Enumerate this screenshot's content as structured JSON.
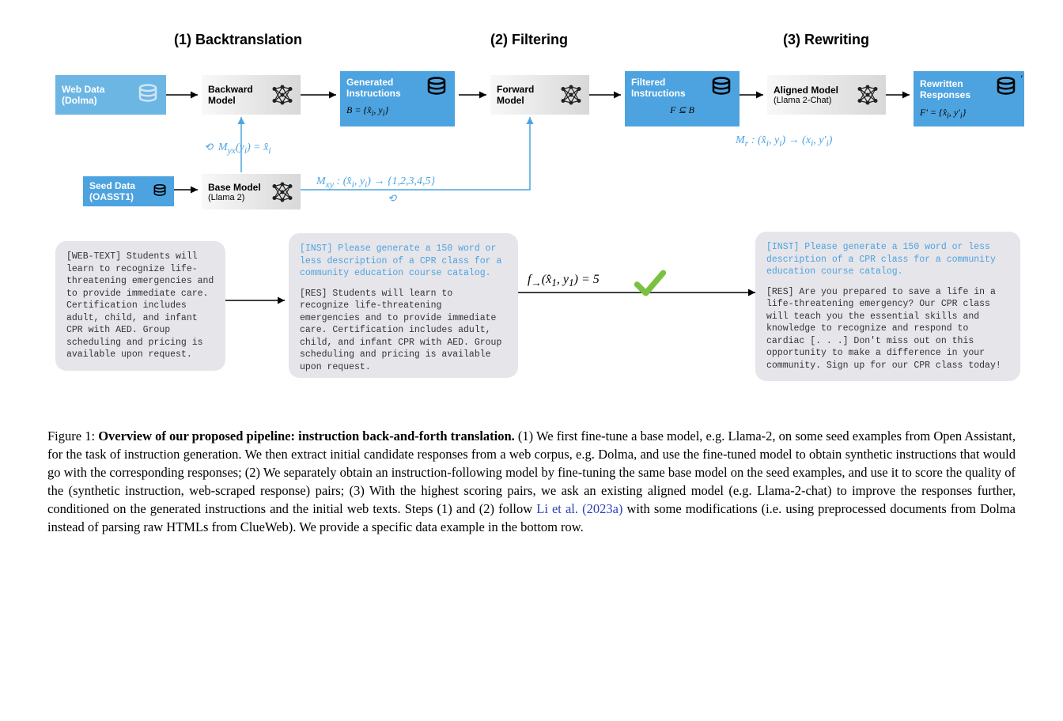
{
  "stages": {
    "s1": "(1) Backtranslation",
    "s2": "(2) Filtering",
    "s3": "(3) Rewriting"
  },
  "boxes": {
    "webdata": "Web Data (Dolma)",
    "seeddata": "Seed Data (OASST1)",
    "backward": "Backward Model",
    "basemodel1": "Base Model",
    "basemodel1b": "(Llama 2)",
    "generated": "Generated Instructions",
    "forward": "Forward Model",
    "filtered": "Filtered Instructions",
    "aligned1": "Aligned Model",
    "aligned2": "(Llama 2-Chat)",
    "rewritten": "Rewritten Responses"
  },
  "math": {
    "myx": "M_{yx}(y_i) = x̂_i",
    "bset": "B = {x̂_i, y_i}",
    "mxy": "M_{xy} : (x̂_i, y_i) → {1,2,3,4,5}",
    "fsub": "F ⊆ B",
    "mr": "M_r : (x̂_i, y_i) → (x_i, y_i')",
    "fprime": "F' = {x̂_i, y_i'}",
    "score": "f_→(x̂_1, y_1) = 5"
  },
  "examples": {
    "webtext": "[WEB-TEXT] Students will learn to recognize life-threatening emergencies and to provide immediate care. Certification includes adult, child, and infant CPR with AED. Group scheduling and pricing is available upon request.",
    "inst1": "[INST] Please generate a 150 word or less description of a CPR class for a community education course catalog.",
    "res1": "[RES] Students will learn to recognize life-threatening emergencies and to provide immediate care. Certification includes adult, child, and infant CPR with AED. Group scheduling and pricing is available upon request.",
    "inst2": "[INST] Please generate a 150 word or less description of a CPR class for a community education course catalog.",
    "res2": "[RES] Are you prepared to save a life in a life-threatening emergency? Our CPR class will teach you the essential skills and knowledge to recognize and respond to cardiac [. . .] Don't miss out on this opportunity to make a difference in your community. Sign up for our CPR class today!"
  },
  "caption": {
    "fignum": "Figure 1: ",
    "boldtitle": "Overview of our proposed pipeline: instruction back-and-forth translation.",
    "body1": " (1) We first fine-tune a base model, e.g. Llama-2, on some seed examples from Open Assistant, for the task of instruction generation. We then extract initial candidate responses from a web corpus, e.g. Dolma, and use the fine-tuned model to obtain synthetic instructions that would go with the corresponding responses; (2) We separately obtain an instruction-following model by fine-tuning the same base model on the seed examples, and use it to score the quality of the (synthetic instruction, web-scraped response) pairs; (3) With the highest scoring pairs, we ask an existing aligned model (e.g. Llama-2-chat) to improve the responses further, conditioned on the generated instructions and the initial web texts. Steps (1) and (2) follow ",
    "link": "Li et al. (2023a)",
    "body2": " with some modifications (i.e. using preprocessed documents from Dolma instead of parsing raw HTMLs from ClueWeb). We provide a specific data example in the bottom row."
  }
}
